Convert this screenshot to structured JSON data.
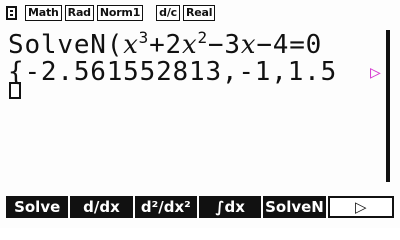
{
  "status": {
    "math_label": "Math",
    "angle_label": "Rad",
    "norm_label": "Norm1",
    "frac_label": "d/c",
    "mode_label": "Real"
  },
  "input": {
    "command": "SolveN(",
    "x1": "x",
    "exp1": "3",
    "plus": "+2",
    "x2": "x",
    "exp2": "2",
    "minus": "−3",
    "x3": "x",
    "rest": "−4=0"
  },
  "output": {
    "result": "{-2.561552813,-1,1.5",
    "more_indicator": "▷"
  },
  "fkeys": {
    "f1": "Solve",
    "f2": "d/dx",
    "f3": "d²/dx²",
    "f4": "∫dx",
    "f5": "SolveN",
    "f6": "▷"
  }
}
